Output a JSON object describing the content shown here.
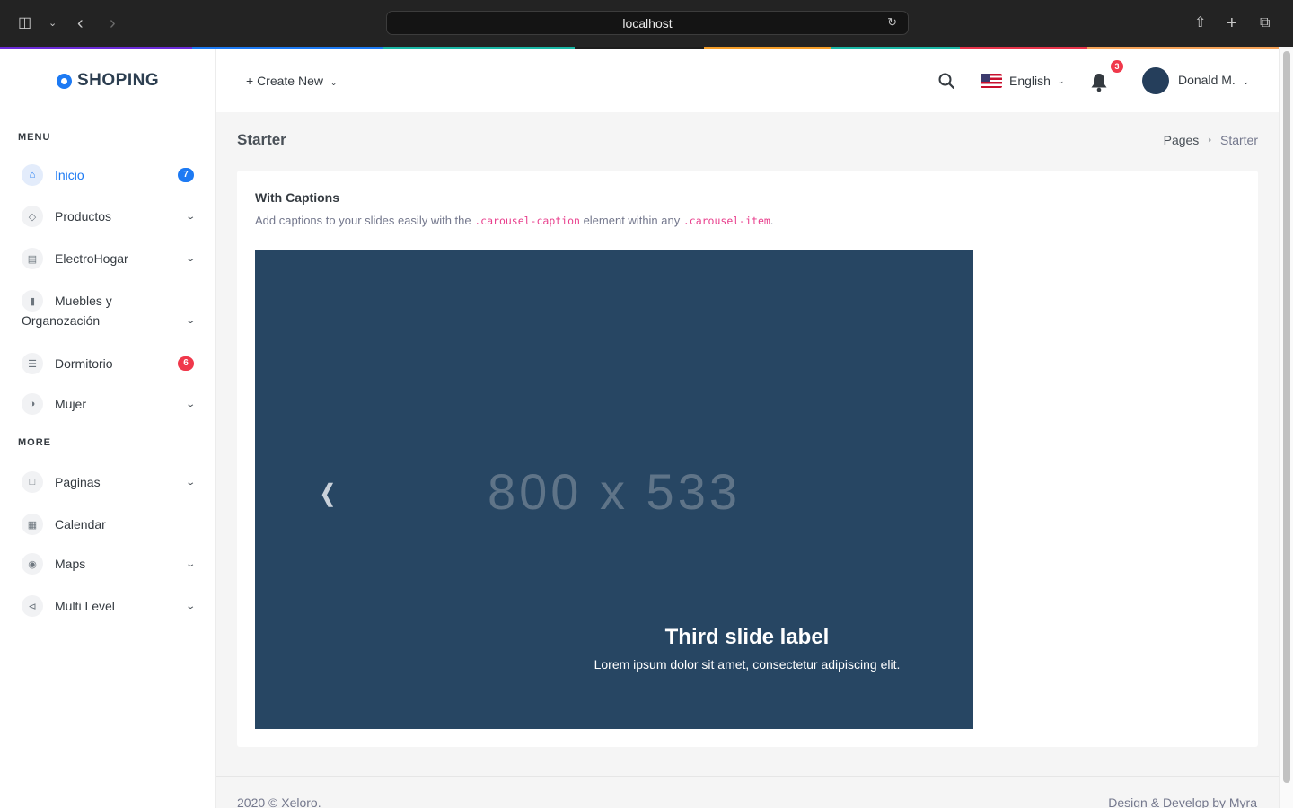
{
  "browser": {
    "url": "localhost",
    "strip_colors": [
      "#6c2bd9",
      "#1d7af3",
      "#1bb8a6",
      "#1d1d1d",
      "#f59f2a",
      "#1bb8a6",
      "#e8344b",
      "#f7a45a"
    ]
  },
  "brand": {
    "name": "SHOPING",
    "accent": "#1d7af3"
  },
  "sidebar": {
    "menu_title": "MENU",
    "more_title": "MORE",
    "items": [
      {
        "label": "Inicio",
        "icon": "home-icon",
        "badge": "7",
        "badge_color": "#1d7af3"
      },
      {
        "label": "Productos",
        "icon": "gem-icon"
      },
      {
        "label": "ElectroHogar",
        "icon": "appliance-icon"
      },
      {
        "label_line1": "Muebles y",
        "label_line2": "Organozación",
        "icon": "bar-chart-icon"
      },
      {
        "label": "Dormitorio",
        "icon": "list-icon",
        "badge": "6",
        "badge_color": "#f0384b"
      },
      {
        "label": "Mujer",
        "icon": "pie-chart-icon"
      }
    ],
    "more_items": [
      {
        "label": "Paginas",
        "icon": "file-icon"
      },
      {
        "label": "Calendar",
        "icon": "calendar-icon"
      },
      {
        "label": "Maps",
        "icon": "map-pin-icon"
      },
      {
        "label": "Multi Level",
        "icon": "share-icon"
      }
    ]
  },
  "topbar": {
    "create_new": "+ Create New",
    "language": "English",
    "notifications_count": "3",
    "user_name": "Donald M."
  },
  "page": {
    "title": "Starter",
    "breadcrumb": [
      "Pages",
      "Starter"
    ]
  },
  "card": {
    "title": "With Captions",
    "desc_prefix": "Add captions to your slides easily with the ",
    "desc_code1": ".carousel-caption",
    "desc_mid": " element within any ",
    "desc_code2": ".carousel-item",
    "desc_suffix": "."
  },
  "carousel": {
    "placeholder": "800 x 533",
    "caption_title": "Third slide label",
    "caption_text": "Lorem ipsum dolor sit amet, consectetur adipiscing elit."
  },
  "footer": {
    "left": "2020 © Xeloro.",
    "right": "Design & Develop by Myra"
  }
}
